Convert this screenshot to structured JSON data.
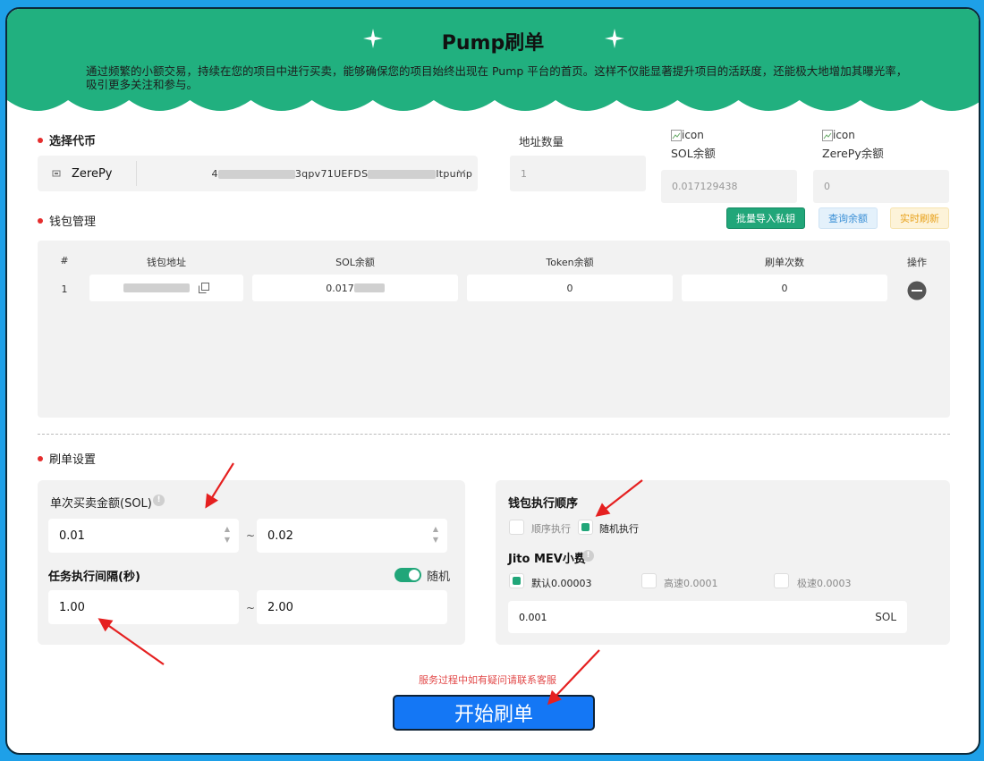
{
  "header": {
    "title": "Pump刷单",
    "description": "通过频繁的小额交易，持续在您的项目中进行买卖，能够确保您的项目始终出现在 Pump 平台的首页。这样不仅能显著提升项目的活跃度，还能极大地增加其曝光率，吸引更多关注和参与。"
  },
  "token_select": {
    "label": "选择代币",
    "token_name": "ZerePy",
    "address_prefix": "4",
    "address_mid": "3qpv71UEFDS",
    "address_suffix": "ltpump"
  },
  "address_count": {
    "label": "地址数量",
    "value": "1"
  },
  "sol_balance": {
    "icon_alt": "icon",
    "label": "SOL余额",
    "value": "0.017129438"
  },
  "token_balance": {
    "icon_alt": "icon",
    "label": "ZerePy余额",
    "value": "0"
  },
  "wallet": {
    "label": "钱包管理",
    "buttons": {
      "import": "批量导入私钥",
      "query": "查询余额",
      "refresh": "实时刷新"
    },
    "columns": [
      "#",
      "钱包地址",
      "SOL余额",
      "Token余额",
      "刷单次数",
      "操作"
    ],
    "rows": [
      {
        "index": "1",
        "address": "",
        "sol": "0.017",
        "token": "0",
        "count": "0"
      }
    ]
  },
  "settings": {
    "label": "刷单设置",
    "amount": {
      "label": "单次买卖金额(SOL)",
      "min": "0.01",
      "max": "0.02"
    },
    "interval": {
      "label": "任务执行间隔(秒)",
      "random_label": "随机",
      "random_on": true,
      "min": "1.00",
      "max": "2.00"
    },
    "order": {
      "label": "钱包执行顺序",
      "options": [
        "顺序执行",
        "随机执行"
      ],
      "selected": 1
    },
    "jito": {
      "label": "Jito MEV小费",
      "options": [
        "默认0.00003",
        "高速0.0001",
        "极速0.0003"
      ],
      "selected": 0,
      "value": "0.001",
      "unit": "SOL"
    },
    "tilde": "~"
  },
  "notice": "服务过程中如有疑问请联系客服",
  "start_button": "开始刷单",
  "colors": {
    "brand_green": "#21b07f",
    "primary_blue": "#1477f5",
    "background_blue": "#1ea0e8",
    "arrow_red": "#e52020"
  }
}
